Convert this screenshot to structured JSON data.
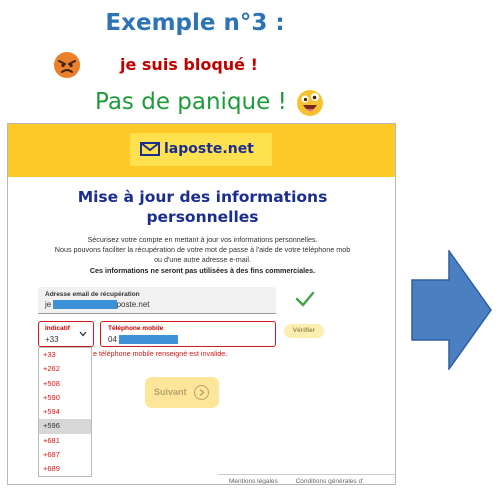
{
  "slide": {
    "title": "Exemple n°3 :",
    "blocked_text": "je suis bloqué !",
    "calm_text": "Pas de panique !",
    "emojis": [
      "angry-face",
      "grinning-face"
    ],
    "colors": {
      "title": "#2e74b5",
      "blocked": "#c00000",
      "calm": "#1e9b3a",
      "arrow": "#4a7fc1"
    }
  },
  "screenshot": {
    "logo_text": "laposte.net",
    "heading": "Mise à jour des informations personnelles",
    "intro_line1": "Sécurisez votre compte en mettant à jour vos informations personnelles.",
    "intro_line2": "Nous pouvons faciliter la récupération de votre mot de passe à l'aide de votre téléphone mob",
    "intro_line3": "ou d'une autre adresse e-mail.",
    "intro_bold": "Ces informations ne seront pas utilisées à des fins commerciales.",
    "email_label": "Adresse email de récupération",
    "email_prefix": "je",
    "email_suffix": "@laposte.net",
    "indicatif_label": "Indicatif",
    "indicatif_value": "+33",
    "phone_label": "Téléphone mobile",
    "phone_prefix": "04",
    "verify_label": "Vérifier",
    "error_text": "e téléphone mobile renseigné est invalide.",
    "dropdown_options": [
      "+33",
      "+262",
      "+508",
      "+590",
      "+594",
      "+596",
      "+681",
      "+687",
      "+689"
    ],
    "dropdown_selected": "+596",
    "submit_label": "Suivant",
    "footer_links": [
      "Mentions légales",
      "Conditions générales d'"
    ],
    "colors": {
      "header": "#fdc929",
      "heading": "#1b2d8f",
      "error": "#d11a1a",
      "check": "#43a047"
    }
  }
}
